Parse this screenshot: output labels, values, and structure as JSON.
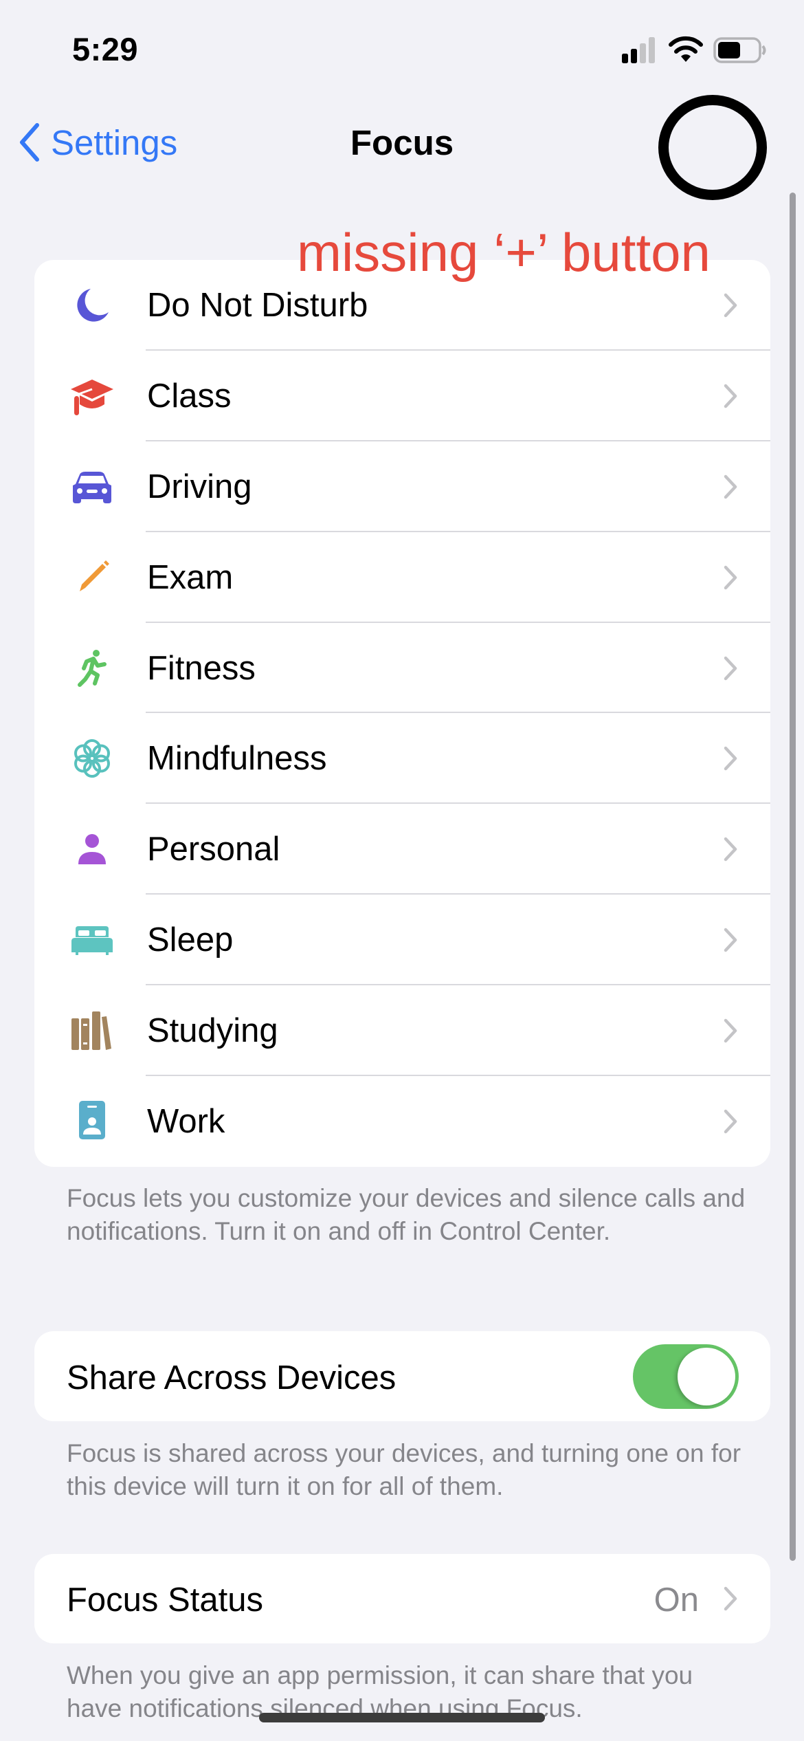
{
  "status_bar": {
    "time": "5:29",
    "icons": [
      "cellular-signal-icon",
      "wifi-icon",
      "battery-icon"
    ]
  },
  "nav": {
    "back_label": "Settings",
    "back_icon": "chevron-left-icon",
    "title": "Focus"
  },
  "annotation": {
    "text": "missing ‘+’ button",
    "color": "#e6493c",
    "circle_icon": "circle-annotation"
  },
  "focus_modes": [
    {
      "label": "Do Not Disturb",
      "icon": "moon-icon",
      "color": "#5856d6"
    },
    {
      "label": "Class",
      "icon": "graduation-cap-icon",
      "color": "#e5483c"
    },
    {
      "label": "Driving",
      "icon": "car-icon",
      "color": "#5856d6"
    },
    {
      "label": "Exam",
      "icon": "pencil-icon",
      "color": "#f09a37"
    },
    {
      "label": "Fitness",
      "icon": "running-figure-icon",
      "color": "#5ec462"
    },
    {
      "label": "Mindfulness",
      "icon": "flower-icon",
      "color": "#58c1bd"
    },
    {
      "label": "Personal",
      "icon": "person-icon",
      "color": "#a554d6"
    },
    {
      "label": "Sleep",
      "icon": "bed-icon",
      "color": "#5dc4c0"
    },
    {
      "label": "Studying",
      "icon": "books-icon",
      "color": "#a2845e"
    },
    {
      "label": "Work",
      "icon": "id-badge-icon",
      "color": "#5aaecb"
    }
  ],
  "footer1": "Focus lets you customize your devices and silence calls and notifications. Turn it on and off in Control Center.",
  "share": {
    "label": "Share Across Devices",
    "toggle_on": true,
    "toggle_color": "#65c466"
  },
  "footer2": "Focus is shared across your devices, and turning one on for this device will turn it on for all of them.",
  "focus_status": {
    "label": "Focus Status",
    "value": "On"
  },
  "footer3": "When you give an app permission, it can share that you have notifications silenced when using Focus."
}
